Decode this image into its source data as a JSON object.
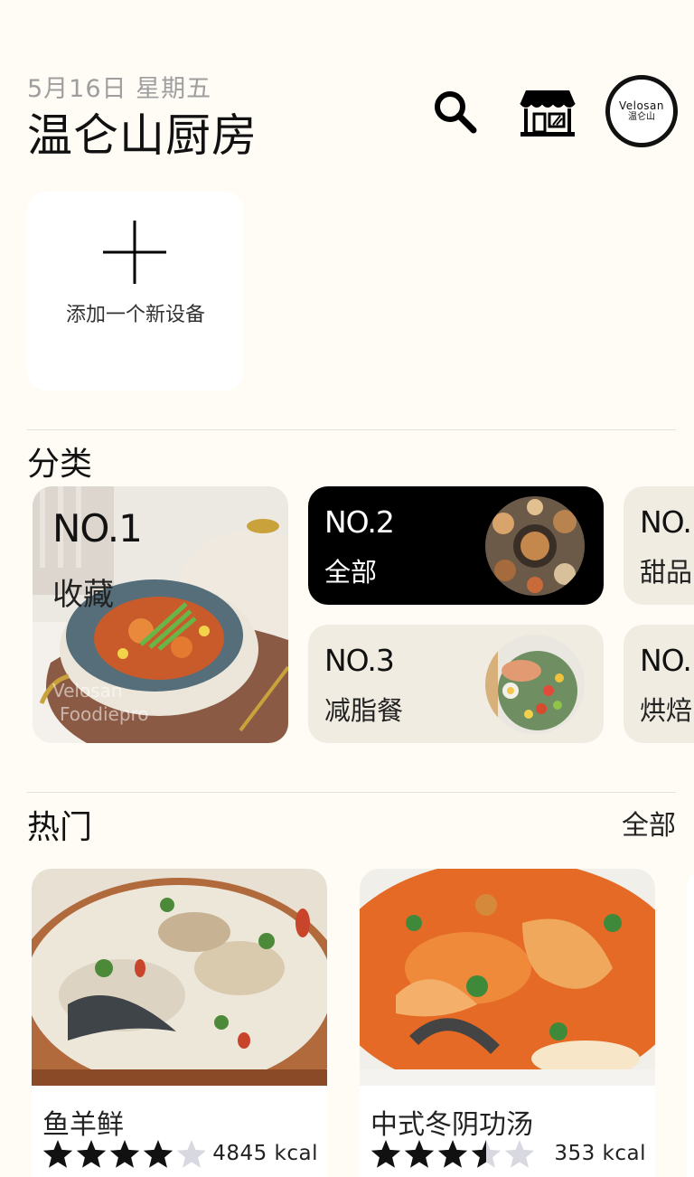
{
  "header": {
    "date": "5月16日 星期五",
    "title": "温仑山厨房",
    "search_icon": "search-icon",
    "shop_icon": "store-icon",
    "avatar_brand": "Velosan",
    "avatar_brand_cn": "温仑山"
  },
  "add_device": {
    "label": "添加一个新设备",
    "icon": "plus-icon"
  },
  "categories": {
    "title": "分类",
    "items": [
      {
        "no": "NO.1",
        "name": "收藏",
        "watermark1": "Velosan",
        "watermark2": "Foodiepro"
      },
      {
        "no": "NO.2",
        "name": "全部"
      },
      {
        "no": "NO.3",
        "name": "减脂餐"
      },
      {
        "no": "NO.",
        "name": "甜品"
      },
      {
        "no": "NO.",
        "name": "烘焙"
      }
    ]
  },
  "hot": {
    "title": "热门",
    "see_all": "全部",
    "recipes": [
      {
        "name": "鱼羊鲜",
        "rating": 4,
        "kcal": "4845 kcal"
      },
      {
        "name": "中式冬阴功汤",
        "rating": 3.5,
        "kcal": "353 kcal"
      }
    ]
  },
  "colors": {
    "background": "#fffcf5",
    "card_light": "#f0ece1",
    "card_dark": "#000000",
    "star_filled": "#111111",
    "star_empty": "#d8d8e0"
  }
}
